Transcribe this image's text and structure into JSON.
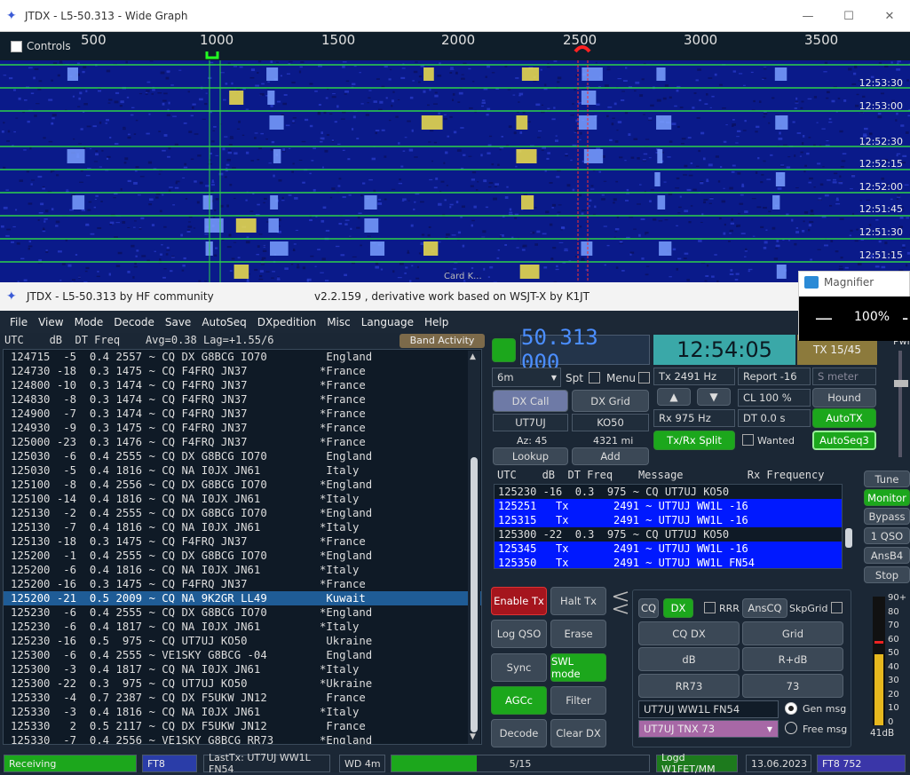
{
  "wide_graph": {
    "title": "JTDX - L5-50.313 - Wide Graph",
    "controls_label": "Controls",
    "scale": [
      "500",
      "1000",
      "1500",
      "2000",
      "2500",
      "3000",
      "3500"
    ],
    "times": [
      "12:53:30",
      "12:53:00",
      "12:52:30",
      "12:52:15",
      "12:52:00",
      "12:51:45",
      "12:51:30",
      "12:51:15"
    ],
    "card_label": "Card K..."
  },
  "main": {
    "title": "JTDX - L5-50.313  by HF community",
    "subtitle": "v2.2.159 , derivative work based on WSJT-X by K1JT",
    "menu": [
      "File",
      "View",
      "Mode",
      "Decode",
      "Save",
      "AutoSeq",
      "DXpedition",
      "Misc",
      "Language",
      "Help"
    ],
    "left_header": "UTC    dB  DT Freq    Avg=0.38 Lag=+1.55/6",
    "band_activity": "Band Activity",
    "rows": [
      "124715  -5  0.4 2557 ~ CQ DX G8BCG IO70         England",
      "124730 -18  0.3 1475 ~ CQ F4FRQ JN37           *France",
      "124800 -10  0.3 1474 ~ CQ F4FRQ JN37           *France",
      "124830  -8  0.3 1474 ~ CQ F4FRQ JN37           *France",
      "124900  -7  0.3 1474 ~ CQ F4FRQ JN37           *France",
      "124930  -9  0.3 1475 ~ CQ F4FRQ JN37           *France",
      "125000 -23  0.3 1476 ~ CQ F4FRQ JN37           *France",
      "125030  -6  0.4 2555 ~ CQ DX G8BCG IO70         England",
      "125030  -5  0.4 1816 ~ CQ NA I0JX JN61          Italy",
      "125100  -8  0.4 2556 ~ CQ DX G8BCG IO70        *England",
      "125100 -14  0.4 1816 ~ CQ NA I0JX JN61         *Italy",
      "125130  -2  0.4 2555 ~ CQ DX G8BCG IO70        *England",
      "125130  -7  0.4 1816 ~ CQ NA I0JX JN61         *Italy",
      "125130 -18  0.3 1475 ~ CQ F4FRQ JN37           *France",
      "125200  -1  0.4 2555 ~ CQ DX G8BCG IO70        *England",
      "125200  -6  0.4 1816 ~ CQ NA I0JX JN61         *Italy",
      "125200 -16  0.3 1475 ~ CQ F4FRQ JN37           *France",
      "125200 -21  0.5 2009 ~ CQ NA 9K2GR LL49         Kuwait",
      "125230  -6  0.4 2555 ~ CQ DX G8BCG IO70        *England",
      "125230  -6  0.4 1817 ~ CQ NA I0JX JN61         *Italy",
      "125230 -16  0.5  975 ~ CQ UT7UJ KO50            Ukraine",
      "125300  -6  0.4 2555 ~ VE1SKY G8BCG -04         England",
      "125300  -3  0.4 1817 ~ CQ NA I0JX JN61         *Italy",
      "125300 -22  0.3  975 ~ CQ UT7UJ KO50           *Ukraine",
      "125330  -4  0.7 2387 ~ CQ DX F5UKW JN12         France",
      "125330  -3  0.4 1816 ~ CQ NA I0JX JN61         *Italy",
      "125330   2  0.5 2117 ~ CQ DX F5UKW JN12         France",
      "125330  -7  0.4 2556 ~ VE1SKY G8BCG RR73       *England"
    ],
    "selected_row": 17,
    "frequency": "50.313 000",
    "clock": "12:54:05",
    "tx_period": "TX 15/45",
    "band": "6m",
    "spt": "Spt",
    "menu_label": "Menu",
    "tx_hz": "Tx  2491  Hz",
    "rx_hz": "Rx  975  Hz",
    "report": "Report -16",
    "cl": "CL  100 %",
    "dt": "DT 0.0 s",
    "s_meter": "S meter",
    "pwr": "Pwr",
    "dx_call_btn": "DX Call",
    "dx_grid_btn": "DX Grid",
    "dx_call": "UT7UJ",
    "dx_grid": "KO50",
    "az": "Az: 45",
    "dist": "4321 mi",
    "lookup": "Lookup",
    "add": "Add",
    "hound": "Hound",
    "autotx": "AutoTX",
    "autoseq3": "AutoSeq3",
    "txrx_split": "Tx/Rx Split",
    "wanted": "Wanted",
    "rx_header": "UTC    dB  DT Freq    Message          Rx Frequency",
    "rx_rows": [
      {
        "t": "125230 -16  0.3  975 ~ CQ UT7UJ KO50",
        "tx": false
      },
      {
        "t": "125251   Tx       2491 ~ UT7UJ WW1L -16",
        "tx": true
      },
      {
        "t": "125315   Tx       2491 ~ UT7UJ WW1L -16",
        "tx": true
      },
      {
        "t": "125300 -22  0.3  975 ~ CQ UT7UJ KO50",
        "tx": false
      },
      {
        "t": "125345   Tx       2491 ~ UT7UJ WW1L -16",
        "tx": true
      },
      {
        "t": "125350   Tx       2491 ~ UT7UJ WW1L FN54",
        "tx": true
      }
    ],
    "side_buttons": [
      "Tune",
      "Monitor",
      "Bypass",
      "1 QSO",
      "AnsB4",
      "Stop"
    ],
    "left_buttons": [
      "Enable Tx",
      "Halt Tx",
      "Log QSO",
      "Erase",
      "Sync",
      "SWL mode",
      "AGCc",
      "Filter",
      "Decode",
      "Clear DX"
    ],
    "cq": "CQ",
    "dx": "DX",
    "rrr": "RRR",
    "anscq": "AnsCQ",
    "skpgrid": "SkpGrid",
    "msg_buttons": [
      "CQ DX",
      "Grid",
      "dB",
      "R+dB",
      "RR73",
      "73"
    ],
    "gen_field": "UT7UJ WW1L FN54",
    "free_field": "UT7UJ TNX 73",
    "gen_msg": "Gen msg",
    "free_msg": "Free msg",
    "meter_labels": [
      "90+",
      "80",
      "70",
      "60",
      "50",
      "40",
      "30",
      "20",
      "10",
      "0"
    ],
    "meter_value": "41dB",
    "meter_level": 0.41,
    "status": {
      "receiving": "Receiving",
      "mode": "FT8",
      "lasttx": "LastTx: UT7UJ WW1L FN54",
      "wd": "WD 4m",
      "progress": "5/15",
      "progress_frac": 0.33,
      "logd": "Logd W1FET/MM",
      "date": "13.06.2023",
      "ft8": "FT8  752"
    }
  },
  "magnifier": {
    "title": "Magnifier",
    "zoom": "100%"
  },
  "colors": {
    "green": "#1ca71c",
    "tx_blue": "#0019ff",
    "freq": "#4b8eff",
    "clock_bg": "#3aa8a8"
  }
}
